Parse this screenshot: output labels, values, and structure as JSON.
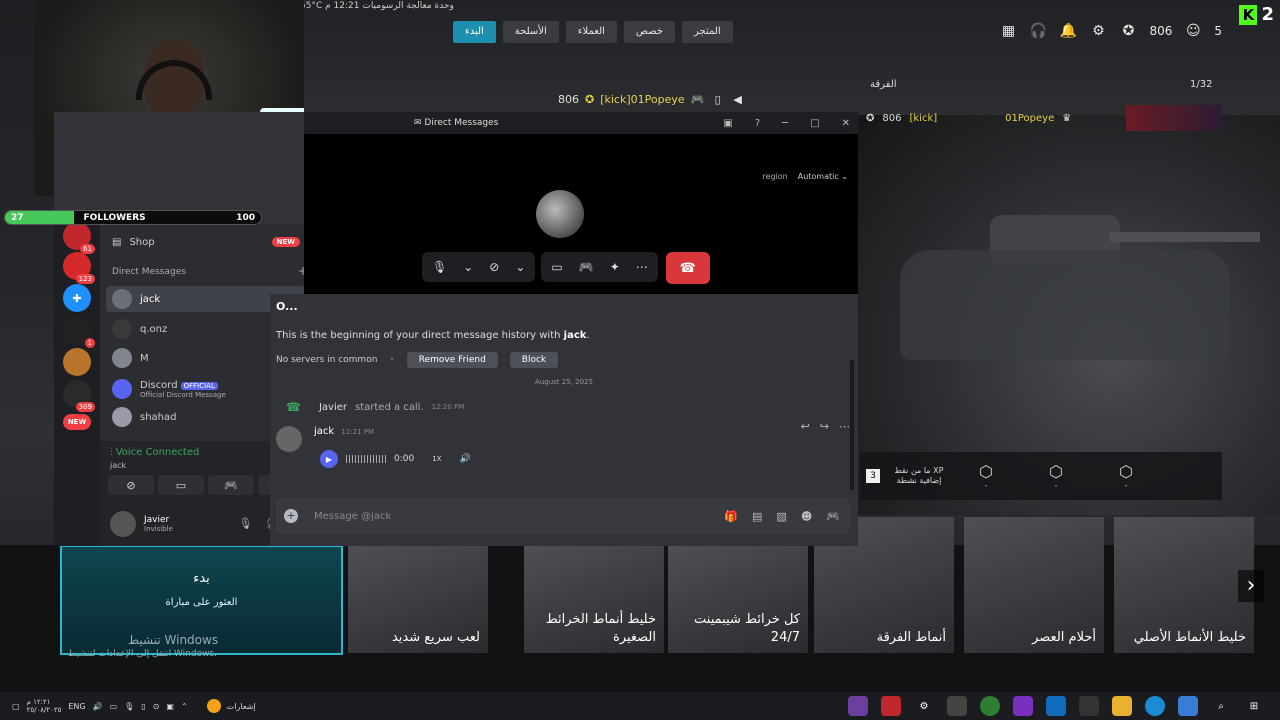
{
  "game": {
    "status_text": "55°C وحدة معالجة الرسوميات  12:21 م",
    "nav_tabs": [
      {
        "label": "البدء",
        "active": true
      },
      {
        "label": "الأسلحة",
        "active": false
      },
      {
        "label": "العملاء",
        "active": false
      },
      {
        "label": "خصص",
        "active": false
      },
      {
        "label": "المتجر",
        "active": false
      }
    ],
    "top_right": {
      "level": "806",
      "party_count": "5"
    },
    "kick_count": "2",
    "player_tag": {
      "level": "806",
      "name": "[kick]01Popeye"
    },
    "squad": {
      "label": "الفرقة",
      "count": "1/32",
      "level": "806",
      "tag": "[kick]",
      "name": "01Popeye"
    },
    "xp_panel": {
      "badge": "3",
      "text": "ما من نقط XP إضافية نشطة",
      "items": [
        "-",
        "-",
        "-"
      ]
    },
    "start_card": {
      "title": "بدء",
      "subtitle": "العثور على مباراة",
      "activate": "تنشيط Windows",
      "activate_sub": "انتقل إلى الإعدادات لتنشيط Windows."
    },
    "thumbnails": [
      {
        "label": "لعب سريع شديد"
      },
      {
        "label": "خليط أنماط الخرائط الصغيرة"
      },
      {
        "label": "كل خرائط شيبمينت 24/7"
      }
    ],
    "thumbnails2": [
      {
        "label": "أنماط الفرقة"
      },
      {
        "label": "أحلام العصر"
      },
      {
        "label": "خليط الأنماط الأصلي"
      }
    ],
    "colors": {
      "accent": "#1f8fb0",
      "kick": "#53fc18"
    }
  },
  "followers": {
    "current": "27",
    "label": "FOLLOWERS",
    "goal": "100",
    "progress": 0.27
  },
  "discord": {
    "window_title": "Direct Messages",
    "region_label": "region",
    "region_value": "Automatic",
    "servers": [
      {
        "badge": "61"
      },
      {
        "badge": "123"
      },
      {
        "badge": ""
      },
      {
        "badge": "1"
      },
      {
        "badge": ""
      },
      {
        "badge": "309"
      },
      {
        "badge": "NEW"
      }
    ],
    "shop_label": "Shop",
    "shop_badge": "NEW",
    "dm_header": "Direct Messages",
    "dms": [
      {
        "name": "jack",
        "sub": "",
        "active": true
      },
      {
        "name": "q.onz",
        "sub": "",
        "active": false
      },
      {
        "name": "M",
        "sub": "",
        "active": false
      },
      {
        "name": "Discord",
        "sub": "Official Discord Message",
        "official": "OFFICIAL",
        "active": false
      },
      {
        "name": "shahad",
        "sub": "",
        "active": false
      }
    ],
    "voice": {
      "status": "Voice Connected",
      "channel": "jack"
    },
    "user": {
      "name": "Javier",
      "status": "Invisible"
    },
    "chat": {
      "name": "O...",
      "begin_prefix": "This is the beginning of your direct message history with ",
      "begin_user": "jack",
      "begin_suffix": ".",
      "no_servers": "No servers in common",
      "remove_friend": "Remove Friend",
      "block": "Block",
      "date_divider": "August 25, 2025",
      "call_user": "Javier",
      "call_text": "started a call.",
      "call_time": "12:20 PM",
      "msg_user": "jack",
      "msg_time": "12:21 PM",
      "voice_time": "0:00",
      "voice_speed": "1X",
      "input_placeholder": "Message @jack"
    },
    "colors": {
      "blurple": "#5865f2",
      "hangup": "#da373c",
      "green": "#3ba55c"
    }
  },
  "taskbar": {
    "lang": "ENG",
    "clock_time": "١٢:٢١ م",
    "clock_date": "٢٥/٠٨/٢٠٢٥",
    "notifications_label": "إشعارات"
  }
}
